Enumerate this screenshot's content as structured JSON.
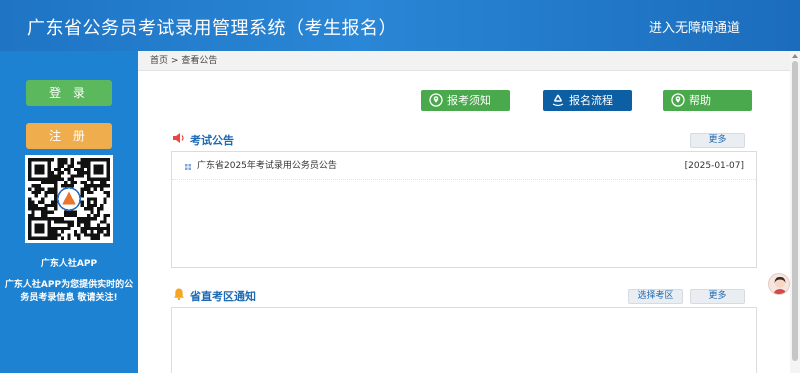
{
  "header": {
    "title": "广东省公务员考试录用管理系统（考生报名）",
    "accessibility": "进入无障碍通道"
  },
  "sidebar": {
    "login_label": "登 录",
    "register_label": "注 册",
    "app_name": "广东人社APP",
    "app_desc": "广东人社APP为您提供实时的公务员考录信息 敬请关注!"
  },
  "breadcrumb": {
    "home": "首页",
    "separator": ">",
    "current": "查看公告"
  },
  "actions": {
    "notice": "报考须知",
    "process": "报名流程",
    "help": "帮助"
  },
  "exam_notices": {
    "title": "考试公告",
    "more": "更多",
    "items": [
      {
        "title": "广东省2025年考试录用公务员公告",
        "date": "[2025-01-07]"
      }
    ]
  },
  "district_notices": {
    "title": "省直考区通知",
    "select": "选择考区",
    "more": "更多"
  },
  "icons": {
    "speaker": "speaker-icon",
    "bell": "bell-icon",
    "location": "location-pin-icon",
    "process": "recycle-icon",
    "bullet": "grid-bullet-icon",
    "avatar": "assistant-avatar"
  },
  "colors": {
    "header": "#1f74c4",
    "sidebar": "#1d82d2",
    "green": "#49a94c",
    "orange": "#f0ad4e",
    "navy": "#0d5fa3",
    "section_title": "#1c69b4"
  }
}
